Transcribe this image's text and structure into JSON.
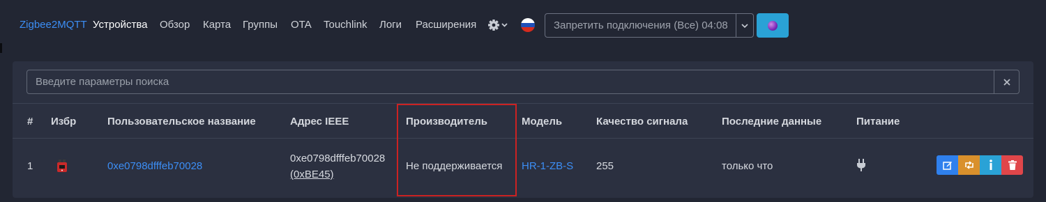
{
  "nav": {
    "brand": "Zigbee2MQTT",
    "items": [
      {
        "label": "Устройства",
        "active": true
      },
      {
        "label": "Обзор"
      },
      {
        "label": "Карта"
      },
      {
        "label": "Группы"
      },
      {
        "label": "OTA"
      },
      {
        "label": "Touchlink"
      },
      {
        "label": "Логи"
      },
      {
        "label": "Расширения"
      }
    ],
    "settings_icon": "gear-icon",
    "language_flag": "russia-flag",
    "permit_join": {
      "label": "Запретить подключения (Все) 04:08"
    },
    "pair_button_icon": "purple-dot"
  },
  "search": {
    "placeholder": "Введите параметры поиска",
    "value": ""
  },
  "table": {
    "headers": [
      "#",
      "Избр",
      "Пользовательское название",
      "Адрес IEEE",
      "Производитель",
      "Модель",
      "Качество сигнала",
      "Последние данные",
      "Питание"
    ],
    "rows": [
      {
        "index": "1",
        "friendly_name": "0xe0798dfffeb70028",
        "ieee": "0xe0798dfffeb70028",
        "nwk": "(0xBE45)",
        "manufacturer": "Не поддерживается",
        "model": "HR-1-ZB-S",
        "lqi": "255",
        "last_seen": "только что",
        "power": "mains-plug-icon"
      }
    ]
  },
  "colors": {
    "background": "#222633",
    "card": "#2b3040",
    "link": "#3c8ef5",
    "highlight": "#cc2222",
    "edit": "#2f80ed",
    "rename": "#d9902c",
    "info": "#2aa2d6",
    "delete": "#e0464a"
  }
}
